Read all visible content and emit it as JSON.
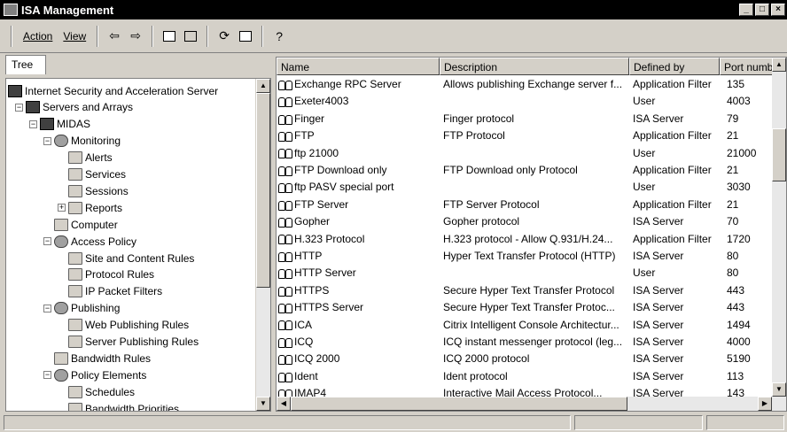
{
  "window": {
    "title": "ISA Management",
    "buttons": {
      "minimize": "_",
      "maximize": "□",
      "close": "×"
    }
  },
  "menu": {
    "action": "Action",
    "view": "View"
  },
  "toolbar_icons": [
    "back-arrow-icon",
    "forward-arrow-icon",
    "up-folder-icon",
    "show-hide-tree-icon",
    "refresh-icon",
    "export-list-icon",
    "help-icon"
  ],
  "tree": {
    "tab_label": "Tree",
    "items": [
      {
        "label": "Internet Security and Acceleration Server",
        "icon": "isa-server-icon",
        "depth": 0
      },
      {
        "label": "Servers and Arrays",
        "icon": "servers-arrays-icon",
        "depth": 1
      },
      {
        "label": "MIDAS",
        "icon": "server-icon",
        "depth": 2
      },
      {
        "label": "Monitoring",
        "icon": "monitoring-icon",
        "depth": 3
      },
      {
        "label": "Alerts",
        "icon": "folder-icon",
        "depth": 4
      },
      {
        "label": "Services",
        "icon": "folder-icon",
        "depth": 4
      },
      {
        "label": "Sessions",
        "icon": "folder-icon",
        "depth": 4
      },
      {
        "label": "Reports",
        "icon": "folder-icon",
        "depth": 4
      },
      {
        "label": "Computer",
        "icon": "folder-icon",
        "depth": 3
      },
      {
        "label": "Access Policy",
        "icon": "access-policy-icon",
        "depth": 3
      },
      {
        "label": "Site and Content Rules",
        "icon": "folder-icon",
        "depth": 4
      },
      {
        "label": "Protocol Rules",
        "icon": "folder-icon",
        "depth": 4
      },
      {
        "label": "IP Packet Filters",
        "icon": "folder-icon",
        "depth": 4
      },
      {
        "label": "Publishing",
        "icon": "publishing-icon",
        "depth": 3
      },
      {
        "label": "Web Publishing Rules",
        "icon": "folder-icon",
        "depth": 4
      },
      {
        "label": "Server Publishing Rules",
        "icon": "folder-icon",
        "depth": 4
      },
      {
        "label": "Bandwidth Rules",
        "icon": "folder-icon",
        "depth": 3
      },
      {
        "label": "Policy Elements",
        "icon": "policy-elements-icon",
        "depth": 3
      },
      {
        "label": "Schedules",
        "icon": "folder-icon",
        "depth": 4
      },
      {
        "label": "Bandwidth Priorities",
        "icon": "folder-icon",
        "depth": 4
      }
    ]
  },
  "list": {
    "columns": [
      "Name",
      "Description",
      "Defined by",
      "Port numb"
    ],
    "rows": [
      {
        "name": "Exchange RPC Server",
        "description": "Allows publishing Exchange server f...",
        "defined_by": "Application Filter",
        "port": "135"
      },
      {
        "name": "Exeter4003",
        "description": "",
        "defined_by": "User",
        "port": "4003"
      },
      {
        "name": "Finger",
        "description": "Finger protocol",
        "defined_by": "ISA Server",
        "port": "79"
      },
      {
        "name": "FTP",
        "description": "FTP Protocol",
        "defined_by": "Application Filter",
        "port": "21"
      },
      {
        "name": "ftp 21000",
        "description": "",
        "defined_by": "User",
        "port": "21000"
      },
      {
        "name": "FTP Download only",
        "description": "FTP Download only Protocol",
        "defined_by": "Application Filter",
        "port": "21"
      },
      {
        "name": "ftp PASV special port",
        "description": "",
        "defined_by": "User",
        "port": "3030"
      },
      {
        "name": "FTP Server",
        "description": "FTP Server Protocol",
        "defined_by": "Application Filter",
        "port": "21"
      },
      {
        "name": "Gopher",
        "description": "Gopher protocol",
        "defined_by": "ISA Server",
        "port": "70"
      },
      {
        "name": "H.323 Protocol",
        "description": "H.323 protocol - Allow Q.931/H.24...",
        "defined_by": "Application Filter",
        "port": "1720"
      },
      {
        "name": "HTTP",
        "description": "Hyper Text Transfer Protocol (HTTP)",
        "defined_by": "ISA Server",
        "port": "80"
      },
      {
        "name": "HTTP Server",
        "description": "",
        "defined_by": "User",
        "port": "80"
      },
      {
        "name": "HTTPS",
        "description": "Secure Hyper Text Transfer Protocol",
        "defined_by": "ISA Server",
        "port": "443"
      },
      {
        "name": "HTTPS Server",
        "description": "Secure Hyper Text Transfer Protoc...",
        "defined_by": "ISA Server",
        "port": "443"
      },
      {
        "name": "ICA",
        "description": "Citrix Intelligent Console Architectur...",
        "defined_by": "ISA Server",
        "port": "1494"
      },
      {
        "name": "ICQ",
        "description": "ICQ instant messenger protocol (leg...",
        "defined_by": "ISA Server",
        "port": "4000"
      },
      {
        "name": "ICQ 2000",
        "description": "ICQ 2000 protocol",
        "defined_by": "ISA Server",
        "port": "5190"
      },
      {
        "name": "Ident",
        "description": "Ident protocol",
        "defined_by": "ISA Server",
        "port": "113"
      },
      {
        "name": "IMAP4",
        "description": "Interactive Mail Access Protocol...",
        "defined_by": "ISA Server",
        "port": "143"
      }
    ]
  }
}
